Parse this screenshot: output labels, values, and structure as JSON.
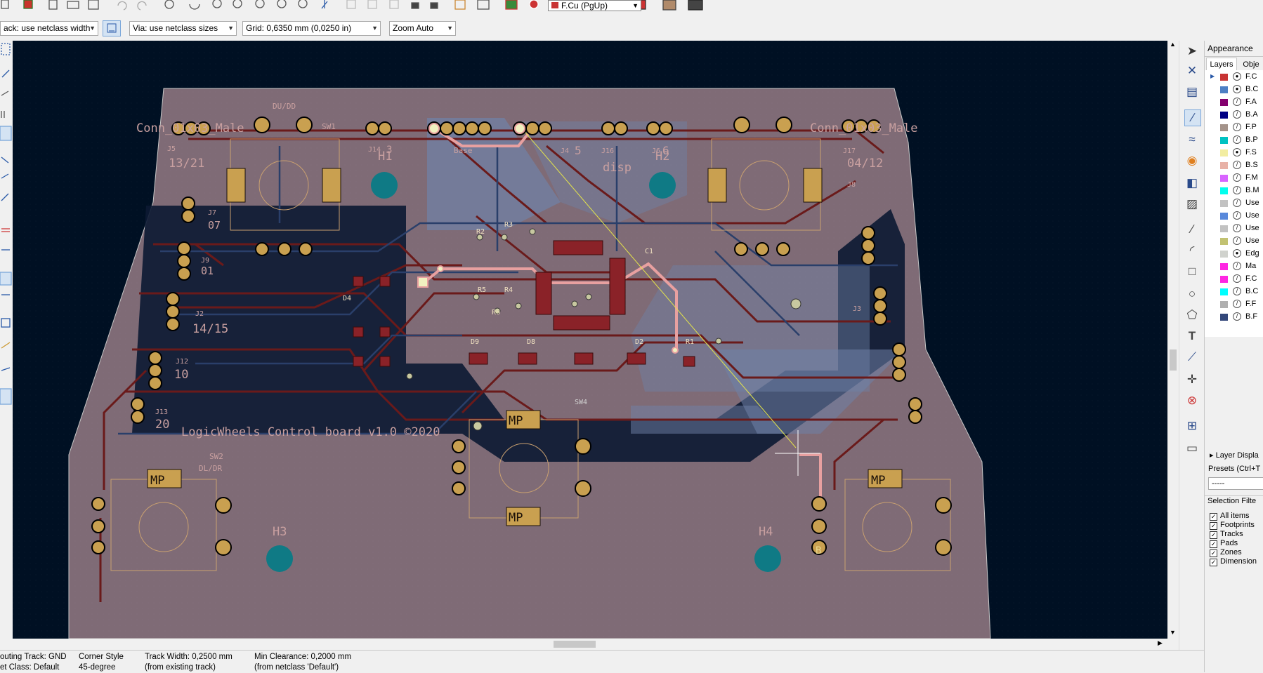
{
  "toolbar": {
    "layer_select": "F.Cu (PgUp)",
    "track_width": "ack: use netclass width",
    "via_size": "Via: use netclass sizes",
    "grid": "Grid: 0,6350 mm (0,0250 in)",
    "zoom": "Zoom Auto",
    "icons": [
      "netlist-icon",
      "new-icon",
      "print-icon",
      "plot-icon",
      "undo-icon",
      "redo-icon",
      "find-icon",
      "refresh-icon",
      "zoom-in-icon",
      "zoom-out-icon",
      "zoom-fit-icon",
      "zoom-object-icon",
      "zoom-area-icon",
      "flip-icon",
      "lock-icon",
      "unlock-icon",
      "drc-icon",
      "footprint-editor-icon",
      "footprint-browser-icon",
      "scripting-icon",
      "python-icon",
      "layer-pair-icon",
      "console-icon"
    ]
  },
  "board": {
    "silk": {
      "title": "LogicWheels Control board v1.0 ©2020",
      "du_dd": "DU/DD",
      "sw1": "SW1",
      "sw2": "SW2",
      "dl_dr": "DL/DR",
      "sw4": "SW4",
      "h1": "H1",
      "h2": "H2",
      "h3": "H3",
      "h4": "H4",
      "j5": "J5",
      "j5_val": "13/21",
      "j17": "J17",
      "j17_val": "04/12",
      "j14": "J14",
      "j14_val": "3",
      "j4": "J4",
      "j4_val": "5",
      "j16": "J16",
      "j16_val": "disp",
      "j6": "J6",
      "j6_val": "6",
      "j7": "J7",
      "j7_val": "07",
      "j9": "J9",
      "j9_val": "01",
      "j2": "J2",
      "j2_val": "14/15",
      "j12": "J12",
      "j12_val": "10",
      "j13": "J13",
      "j13_val": "20",
      "j8": "J8",
      "j3": "J3",
      "c1": "C1",
      "d4": "D4",
      "d9": "D9",
      "d8": "D8",
      "d2": "D2",
      "r5": "R5",
      "r4": "R4",
      "r6": "R6",
      "r2": "R2",
      "r3": "R3",
      "r1": "R1",
      "conn_male": "Conn_01x03_Male",
      "base": "Base",
      "mp": "MP",
      "pad_b": "B"
    }
  },
  "appearance": {
    "title": "Appearance",
    "tabs": [
      "Layers",
      "Obje"
    ],
    "layers": [
      {
        "name": "F.C",
        "color": "#c83434",
        "visible": true
      },
      {
        "name": "B.C",
        "color": "#4d7fc4",
        "visible": true
      },
      {
        "name": "F.A",
        "color": "#84006e",
        "visible": false
      },
      {
        "name": "B.A",
        "color": "#000084",
        "visible": false
      },
      {
        "name": "F.P",
        "color": "#a4938a",
        "visible": false
      },
      {
        "name": "B.P",
        "color": "#00c2c2",
        "visible": false
      },
      {
        "name": "F.S",
        "color": "#f2eda1",
        "visible": true
      },
      {
        "name": "B.S",
        "color": "#e8b2a7",
        "visible": false
      },
      {
        "name": "F.M",
        "color": "#d864ff",
        "visible": false
      },
      {
        "name": "B.M",
        "color": "#02ffee",
        "visible": false
      },
      {
        "name": "Use",
        "color": "#c2c2c2",
        "visible": false
      },
      {
        "name": "Use",
        "color": "#5989db",
        "visible": false
      },
      {
        "name": "Use",
        "color": "#c2c2c2",
        "visible": false
      },
      {
        "name": "Use",
        "color": "#c2c272",
        "visible": false
      },
      {
        "name": "Edg",
        "color": "#d0d2cd",
        "visible": true
      },
      {
        "name": "Ma",
        "color": "#ff26e2",
        "visible": false
      },
      {
        "name": "F.C",
        "color": "#ff26e2",
        "visible": false
      },
      {
        "name": "B.C",
        "color": "#00ffff",
        "visible": false
      },
      {
        "name": "F.F",
        "color": "#afafaf",
        "visible": false
      },
      {
        "name": "B.F",
        "color": "#33477a",
        "visible": false
      }
    ],
    "layer_display": "Layer Displa",
    "presets_label": "Presets (Ctrl+T",
    "presets_value": "-----",
    "selection_filter": "Selection Filte",
    "filters": [
      "All items",
      "Footprints",
      "Tracks",
      "Pads",
      "Zones",
      "Dimension"
    ]
  },
  "status": {
    "routing_track": "outing Track: GND",
    "net_class": "et Class: Default",
    "corner_style_label": "Corner Style",
    "corner_style_value": "45-degree",
    "track_width": "Track Width: 0,2500 mm",
    "track_width_src": "(from existing track)",
    "min_clearance": "Min Clearance: 0,2000 mm",
    "min_clearance_src": "(from netclass 'Default')"
  }
}
